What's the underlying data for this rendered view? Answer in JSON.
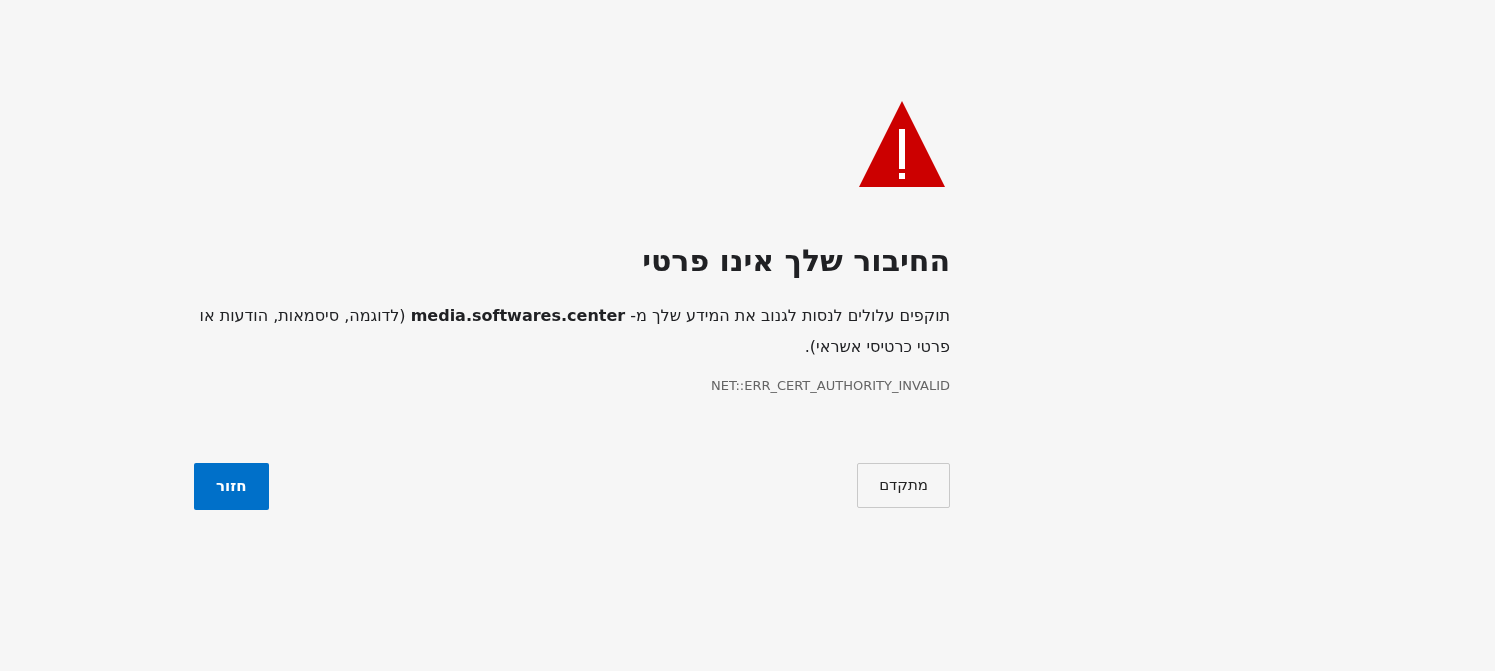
{
  "heading": "החיבור שלך אינו פרטי",
  "message": "תוקפים עלולים לנסות לגנוב את המידע שלך מ- **media.softwares.center** (לדוגמה, סיסמאות, הודעות או פרטי כרטיסי אשראי).",
  "error_code": "NET::ERR_CERT_AUTHORITY_INVALID",
  "buttons": [
    {
      "label": "מתקדם",
      "kind": "secondary"
    },
    {
      "label": "חזור",
      "kind": "primary"
    }
  ]
}
